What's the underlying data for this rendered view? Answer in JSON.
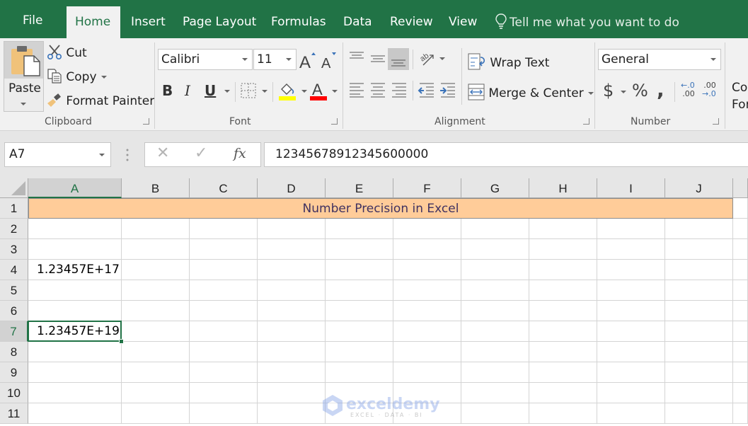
{
  "tabs": {
    "file": "File",
    "home": "Home",
    "insert": "Insert",
    "page_layout": "Page Layout",
    "formulas": "Formulas",
    "data": "Data",
    "review": "Review",
    "view": "View",
    "tell_me": "Tell me what you want to do"
  },
  "ribbon": {
    "clipboard": {
      "label": "Clipboard",
      "paste": "Paste",
      "cut": "Cut",
      "copy": "Copy",
      "format_painter": "Format Painter"
    },
    "font": {
      "label": "Font",
      "font_name": "Calibri",
      "font_size": "11",
      "bold": "B",
      "italic": "I",
      "underline": "U",
      "fill_color": "#ffff00",
      "font_color": "#ff0000"
    },
    "alignment": {
      "label": "Alignment",
      "wrap_text": "Wrap Text",
      "merge_center": "Merge & Center"
    },
    "number": {
      "label": "Number",
      "format": "General",
      "currency": "$",
      "percent": "%",
      "comma": ",",
      "inc_decimal_top": "←.0",
      "inc_decimal_bottom": ".00",
      "dec_decimal_top": ".00",
      "dec_decimal_bottom": "→.0"
    },
    "styles": {
      "conditional_formatting_partial_1": "Co",
      "conditional_formatting_partial_2": "For"
    }
  },
  "formula_bar": {
    "name_box": "A7",
    "cancel": "✕",
    "enter": "✓",
    "fx": "fx",
    "value": "12345678912345600000"
  },
  "sheet": {
    "columns": [
      "A",
      "B",
      "C",
      "D",
      "E",
      "F",
      "G",
      "H",
      "I",
      "J"
    ],
    "rows": [
      "1",
      "2",
      "3",
      "4",
      "5",
      "6",
      "7",
      "8",
      "9",
      "10",
      "11"
    ],
    "title": "Number Precision in Excel",
    "cells": {
      "A4": "1.23457E+17",
      "A7": "1.23457E+19"
    },
    "selected_cell": "A7",
    "title_fill": "#ffcc99",
    "title_color": "#3f3160"
  },
  "watermark": {
    "name": "exceldemy",
    "tagline": "EXCEL · DATA · BI"
  },
  "colors": {
    "accent": "#217346"
  }
}
